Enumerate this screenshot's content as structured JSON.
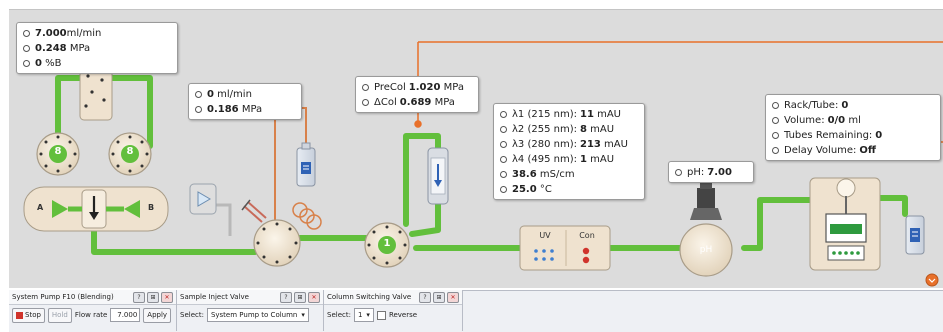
{
  "colors": {
    "tubing": "#62bf3c",
    "callout": "#e8702a",
    "panel": "#dcdcdc",
    "module": "#efe2cf",
    "bottle": "#2f62b5"
  },
  "pump_box": {
    "flow_value": "7.000",
    "flow_unit": "ml/min",
    "pressure_value": "0.248",
    "pressure_unit": "MPa",
    "b_value": "0",
    "b_unit": "%B"
  },
  "pump_module": {
    "left_valve": "8",
    "right_valve": "8",
    "inlet_a": "A",
    "inlet_b": "B"
  },
  "inject_box": {
    "flow_value": "0",
    "flow_unit": "ml/min",
    "pressure_value": "0.186",
    "pressure_unit": "MPa"
  },
  "column_box": {
    "precol_label": "PreCol",
    "precol_value": "1.020",
    "delta_label": "ΔCol",
    "delta_value": "0.689",
    "unit": "MPa"
  },
  "column_valve": {
    "position": "1"
  },
  "detector_box": {
    "rows": [
      {
        "label": "λ1 (215 nm):",
        "value": "11",
        "unit": "mAU"
      },
      {
        "label": "λ2 (255 nm):",
        "value": "8",
        "unit": "mAU"
      },
      {
        "label": "λ3 (280 nm):",
        "value": "213",
        "unit": "mAU"
      },
      {
        "label": "λ4 (495 nm):",
        "value": "1",
        "unit": "mAU"
      },
      {
        "label": "",
        "value": "38.6",
        "unit": "mS/cm"
      },
      {
        "label": "",
        "value": "25.0",
        "unit": "°C"
      }
    ],
    "uv_label": "UV",
    "con_label": "Con"
  },
  "ph_box": {
    "label": "pH:",
    "value": "7.00",
    "module_label": "pH"
  },
  "fraction_box": {
    "rack_label": "Rack/Tube:",
    "rack_value": "0",
    "volume_label": "Volume:",
    "volume_value": "0/0",
    "volume_unit": "ml",
    "tubes_label": "Tubes Remaining:",
    "tubes_value": "0",
    "delay_label": "Delay Volume:",
    "delay_value": "Off"
  },
  "panels": {
    "system_pump": {
      "title": "System Pump F10 (Blending)",
      "stop_label": "Stop",
      "hold_label": "Hold",
      "flow_rate_label": "Flow rate",
      "flow_rate_value": "7.000",
      "apply_label": "Apply"
    },
    "sample_inject": {
      "title": "Sample Inject Valve",
      "select_label": "Select:",
      "select_value": "System Pump to Column"
    },
    "column_switching": {
      "title": "Column Switching Valve",
      "select_label": "Select:",
      "select_value": "1",
      "reverse_label": "Reverse"
    },
    "window_buttons": {
      "help": "?",
      "pin": "⊞",
      "close": "✕"
    }
  }
}
